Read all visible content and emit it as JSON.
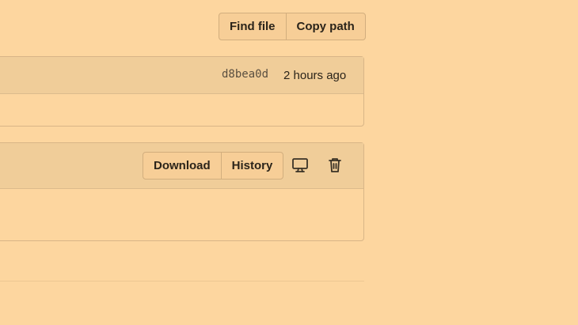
{
  "file_actions": {
    "find_file_label": "Find file",
    "copy_path_label": "Copy path"
  },
  "commit": {
    "sha": "d8bea0d",
    "time": "2 hours ago"
  },
  "blob_header": {
    "download_label": "Download",
    "history_label": "History",
    "icons": [
      "monitor-icon",
      "trash-icon"
    ]
  }
}
